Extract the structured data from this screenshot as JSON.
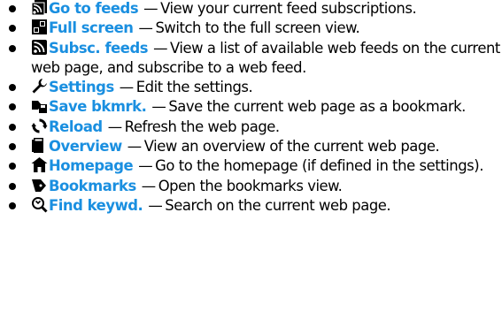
{
  "items": [
    {
      "icon": "feeds-icon",
      "label": "Go to feeds",
      "desc": "View your current feed subscriptions."
    },
    {
      "icon": "fullscreen-icon",
      "label": "Full screen",
      "desc": "Switch to the full screen view."
    },
    {
      "icon": "rss-icon",
      "label": "Subsc. feeds",
      "desc": "View a list of available web feeds on the current web page, and subscribe to a web feed."
    },
    {
      "icon": "wrench-icon",
      "label": "Settings",
      "desc": "Edit the settings."
    },
    {
      "icon": "save-bookmark-icon",
      "label": "Save bkmrk.",
      "desc": "Save the current web page as a bookmark."
    },
    {
      "icon": "reload-icon",
      "label": "Reload",
      "desc": "Refresh the web page."
    },
    {
      "icon": "overview-icon",
      "label": "Overview",
      "desc": "View an overview of the current web page."
    },
    {
      "icon": "home-icon",
      "label": "Homepage",
      "desc": "Go to the homepage (if defined in the settings)."
    },
    {
      "icon": "bookmark-icon",
      "label": "Bookmarks",
      "desc": "Open the bookmarks view."
    },
    {
      "icon": "find-icon",
      "label": "Find keywd.",
      "desc": "Search on the current web page."
    }
  ],
  "separator": "—"
}
